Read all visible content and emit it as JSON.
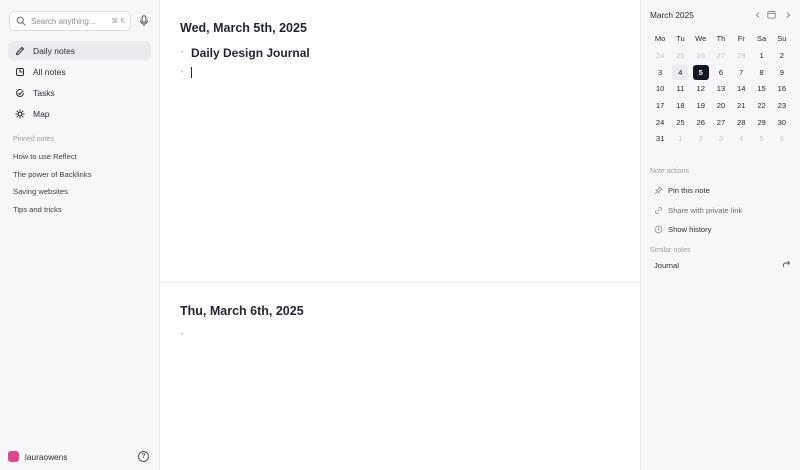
{
  "sidebar": {
    "search": {
      "placeholder": "Search anything...",
      "shortcut": "⌘ K"
    },
    "nav": [
      {
        "label": "Daily notes",
        "icon": "pencil-icon",
        "active": true
      },
      {
        "label": "All notes",
        "icon": "notes-icon",
        "active": false
      },
      {
        "label": "Tasks",
        "icon": "check-circle-icon",
        "active": false
      },
      {
        "label": "Map",
        "icon": "map-icon",
        "active": false
      }
    ],
    "pinned_header": "Pinned notes",
    "pinned": [
      "How to use Reflect",
      "The power of Backlinks",
      "Saving websites",
      "Tips and tricks"
    ],
    "user": {
      "name": "lauraowens",
      "avatar_color": "#e2478a"
    }
  },
  "main": {
    "days": [
      {
        "title": "Wed, March 5th, 2025",
        "heading": "Daily Design Journal"
      },
      {
        "title": "Thu, March 6th, 2025"
      }
    ]
  },
  "calendar": {
    "title": "March 2025",
    "weekdays": [
      "Mo",
      "Tu",
      "We",
      "Th",
      "Fr",
      "Sa",
      "Su"
    ],
    "weeks": [
      [
        "24",
        "25",
        "26",
        "27",
        "28",
        "1",
        "2"
      ],
      [
        "3",
        "4",
        "5",
        "6",
        "7",
        "8",
        "9"
      ],
      [
        "10",
        "11",
        "12",
        "13",
        "14",
        "15",
        "16"
      ],
      [
        "17",
        "18",
        "19",
        "20",
        "21",
        "22",
        "23"
      ],
      [
        "24",
        "25",
        "26",
        "27",
        "28",
        "29",
        "30"
      ],
      [
        "31",
        "1",
        "2",
        "3",
        "4",
        "5",
        "6"
      ]
    ],
    "selected": "5",
    "today_highlight": "4",
    "selected_color": "#101624"
  },
  "note_actions": {
    "label": "Note actions",
    "items": [
      {
        "label": "Pin this note",
        "icon": "pin-icon",
        "dim": false
      },
      {
        "label": "Share with private link",
        "icon": "link-icon",
        "dim": true
      },
      {
        "label": "Show history",
        "icon": "clock-icon",
        "dim": false
      }
    ]
  },
  "similar_notes": {
    "label": "Similar notes",
    "items": [
      {
        "label": "Journal",
        "icon": "forward-icon"
      }
    ]
  }
}
